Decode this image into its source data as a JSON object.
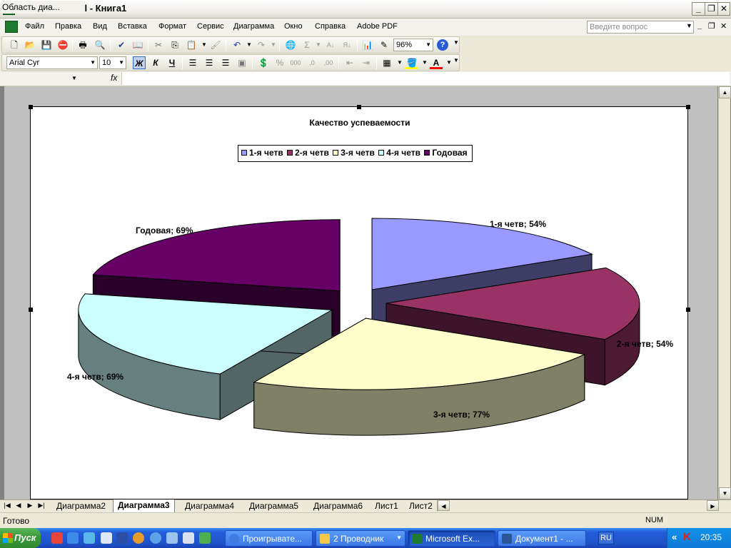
{
  "window": {
    "title": "Microsoft Excel - Книга1",
    "icon_label": "X",
    "minimize": "_",
    "restore": "❐",
    "close": "✕"
  },
  "menu": {
    "items": [
      "Файл",
      "Правка",
      "Вид",
      "Вставка",
      "Формат",
      "Сервис",
      "Диаграмма",
      "Окно",
      "Справка",
      "Adobe PDF"
    ],
    "ask_placeholder": "Введите вопрос"
  },
  "toolbar": {
    "zoom": "96%",
    "font": "Arial Cyr",
    "font_size": "10",
    "bold": "Ж",
    "italic": "К",
    "underline": "Ч"
  },
  "formula": {
    "name_box": "Область диа...",
    "fx": "fx",
    "value": ""
  },
  "chart_data": {
    "type": "pie",
    "title": "Качество успеваемости",
    "legend_position": "top",
    "slices": [
      {
        "name": "1-я четв",
        "value": 54,
        "label": "1-я четв; 54%",
        "color": "#9999ff"
      },
      {
        "name": "2-я четв",
        "value": 54,
        "label": "2-я четв; 54%",
        "color": "#993366"
      },
      {
        "name": "3-я четв",
        "value": 77,
        "label": "3-я четв; 77%",
        "color": "#ffffcc"
      },
      {
        "name": "4-я четв",
        "value": 69,
        "label": "4-я четв; 69%",
        "color": "#ccffff"
      },
      {
        "name": "Годовая",
        "value": 69,
        "label": "Годовая; 69%",
        "color": "#660066"
      }
    ]
  },
  "sheets": {
    "tabs": [
      "Диаграмма2",
      "Диаграмма3",
      "Диаграмма4",
      "Диаграмма5",
      "Диаграмма6",
      "Лист1",
      "Лист2"
    ],
    "active": "Диаграмма3"
  },
  "status": {
    "left": "Готово",
    "num": "NUM"
  },
  "taskbar": {
    "start": "Пуск",
    "buttons": [
      "Проигрывате...",
      "2 Проводник",
      "Microsoft Ex...",
      "Документ1 - ..."
    ],
    "lang": "RU",
    "time": "20:35",
    "chevron": "«"
  }
}
